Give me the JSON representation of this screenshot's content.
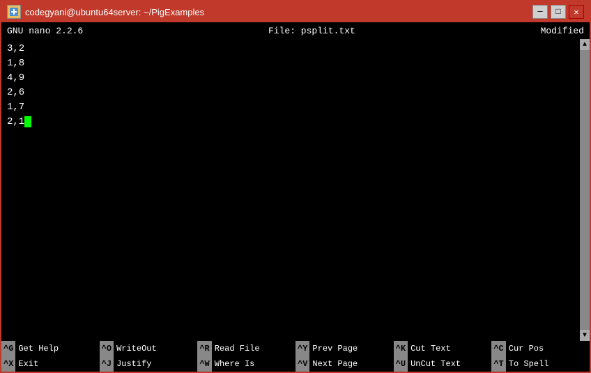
{
  "titlebar": {
    "title": "codegyani@ubuntu64server: ~/PigExamples",
    "minimize": "─",
    "maximize": "□",
    "close": "✕"
  },
  "nano": {
    "header": {
      "version": "GNU nano 2.2.6",
      "file": "File: psplit.txt",
      "status": "Modified"
    },
    "content": {
      "lines": [
        "3,2",
        "1,8",
        "4,9",
        "2,6",
        "1,7",
        "2,1"
      ]
    },
    "footer": {
      "row1": [
        {
          "key": "^G",
          "label": "Get Help"
        },
        {
          "key": "^O",
          "label": "WriteOut"
        },
        {
          "key": "^R",
          "label": "Read File"
        },
        {
          "key": "^Y",
          "label": "Prev Page"
        },
        {
          "key": "^K",
          "label": "Cut Text"
        },
        {
          "key": "^C",
          "label": "Cur Pos"
        }
      ],
      "row2": [
        {
          "key": "^X",
          "label": "Exit"
        },
        {
          "key": "^J",
          "label": "Justify"
        },
        {
          "key": "^W",
          "label": "Where Is"
        },
        {
          "key": "^V",
          "label": "Next Page"
        },
        {
          "key": "^U",
          "label": "UnCut Text"
        },
        {
          "key": "^T",
          "label": "To Spell"
        }
      ]
    }
  }
}
